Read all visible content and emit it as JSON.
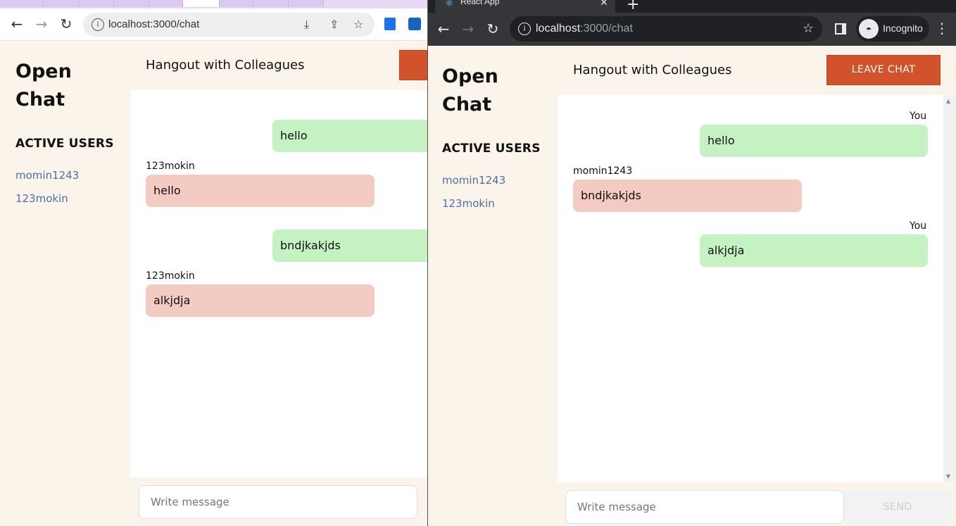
{
  "left_window": {
    "address": "localhost:3000/chat",
    "app": {
      "brand_line1": "Open",
      "brand_line2": "Chat",
      "active_users_heading": "ACTIVE USERS",
      "users": [
        "momin1243",
        "123mokin"
      ],
      "room_title": "Hangout with Colleagues",
      "messages": [
        {
          "sender": "",
          "text": "hello",
          "own": true
        },
        {
          "sender": "123mokin",
          "text": "hello",
          "own": false
        },
        {
          "sender": "",
          "text": "bndjkakjds",
          "own": true
        },
        {
          "sender": "123mokin",
          "text": "alkjdja",
          "own": false
        }
      ],
      "input_placeholder": "Write message"
    }
  },
  "right_window": {
    "tab_title": "React App",
    "address_host": "localhost",
    "address_path": ":3000/chat",
    "incognito_label": "Incognito",
    "app": {
      "brand_line1": "Open",
      "brand_line2": "Chat",
      "active_users_heading": "ACTIVE USERS",
      "users": [
        "momin1243",
        "123mokin"
      ],
      "room_title": "Hangout with Colleagues",
      "leave_button": "LEAVE CHAT",
      "messages": [
        {
          "sender": "You",
          "text": "hello",
          "own": true
        },
        {
          "sender": "momin1243",
          "text": "bndjkakjds",
          "own": false
        },
        {
          "sender": "You",
          "text": "alkjdja",
          "own": true
        }
      ],
      "input_placeholder": "Write message",
      "send_button": "SEND"
    }
  },
  "colors": {
    "accent": "#d2522b",
    "own_bubble": "#c4f2c2",
    "other_bubble": "#f3cbc2",
    "panel_bg": "#faf4ea",
    "user_link": "#4f6fa3"
  }
}
